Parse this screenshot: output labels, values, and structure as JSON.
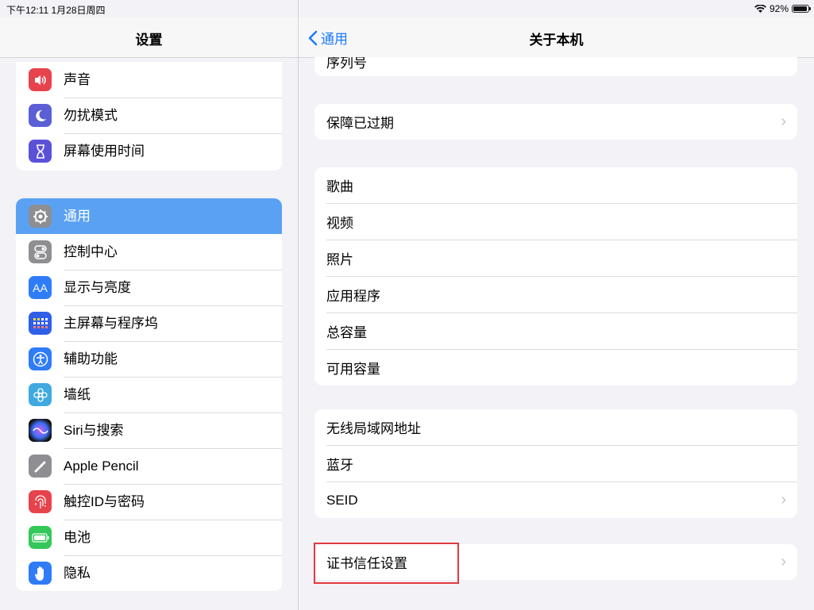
{
  "status": {
    "time": "下午12:11   1月28日周四",
    "battery": "92%",
    "battery_fraction": 0.92
  },
  "settings": {
    "title": "设置",
    "group1": [
      {
        "label": "声音",
        "icon": "speaker-icon",
        "color": "#e7434c"
      },
      {
        "label": "勿扰模式",
        "icon": "moon-icon",
        "color": "#5b5fd6"
      },
      {
        "label": "屏幕使用时间",
        "icon": "hourglass-icon",
        "color": "#5b51d8"
      }
    ],
    "group2": [
      {
        "label": "通用",
        "icon": "gear-icon",
        "color": "#8e8e93",
        "selected": true
      },
      {
        "label": "控制中心",
        "icon": "toggles-icon",
        "color": "#8e8e93"
      },
      {
        "label": "显示与亮度",
        "icon": "text-size-icon",
        "color": "#2f7cf6"
      },
      {
        "label": "主屏幕与程序坞",
        "icon": "grid-icon",
        "color": "#2f5fe6"
      },
      {
        "label": "辅助功能",
        "icon": "accessibility-icon",
        "color": "#2f7cf6"
      },
      {
        "label": "墙纸",
        "icon": "flower-icon",
        "color": "#3fa9e0"
      },
      {
        "label": "Siri与搜索",
        "icon": "siri-icon",
        "color": "#222222"
      },
      {
        "label": "Apple Pencil",
        "icon": "pencil-icon",
        "color": "#8e8e93"
      },
      {
        "label": "触控ID与密码",
        "icon": "fingerprint-icon",
        "color": "#e7434c"
      },
      {
        "label": "电池",
        "icon": "battery-icon",
        "color": "#34c759"
      },
      {
        "label": "隐私",
        "icon": "hand-icon",
        "color": "#2f7cf6"
      }
    ]
  },
  "about": {
    "back": "通用",
    "title": "关于本机",
    "partial_row": {
      "label": "序列号",
      "value": ""
    },
    "warranty": {
      "label": "保障已过期"
    },
    "stats": [
      {
        "label": "歌曲",
        "value": ""
      },
      {
        "label": "视频",
        "value": ""
      },
      {
        "label": "照片",
        "value": ""
      },
      {
        "label": "应用程序",
        "value": ""
      },
      {
        "label": "总容量",
        "value": ""
      },
      {
        "label": "可用容量",
        "value": ""
      }
    ],
    "network": [
      {
        "label": "无线局域网地址",
        "value": ""
      },
      {
        "label": "蓝牙",
        "value": ""
      },
      {
        "label": "SEID",
        "chevron": true
      }
    ],
    "certificate": {
      "label": "证书信任设置"
    }
  }
}
